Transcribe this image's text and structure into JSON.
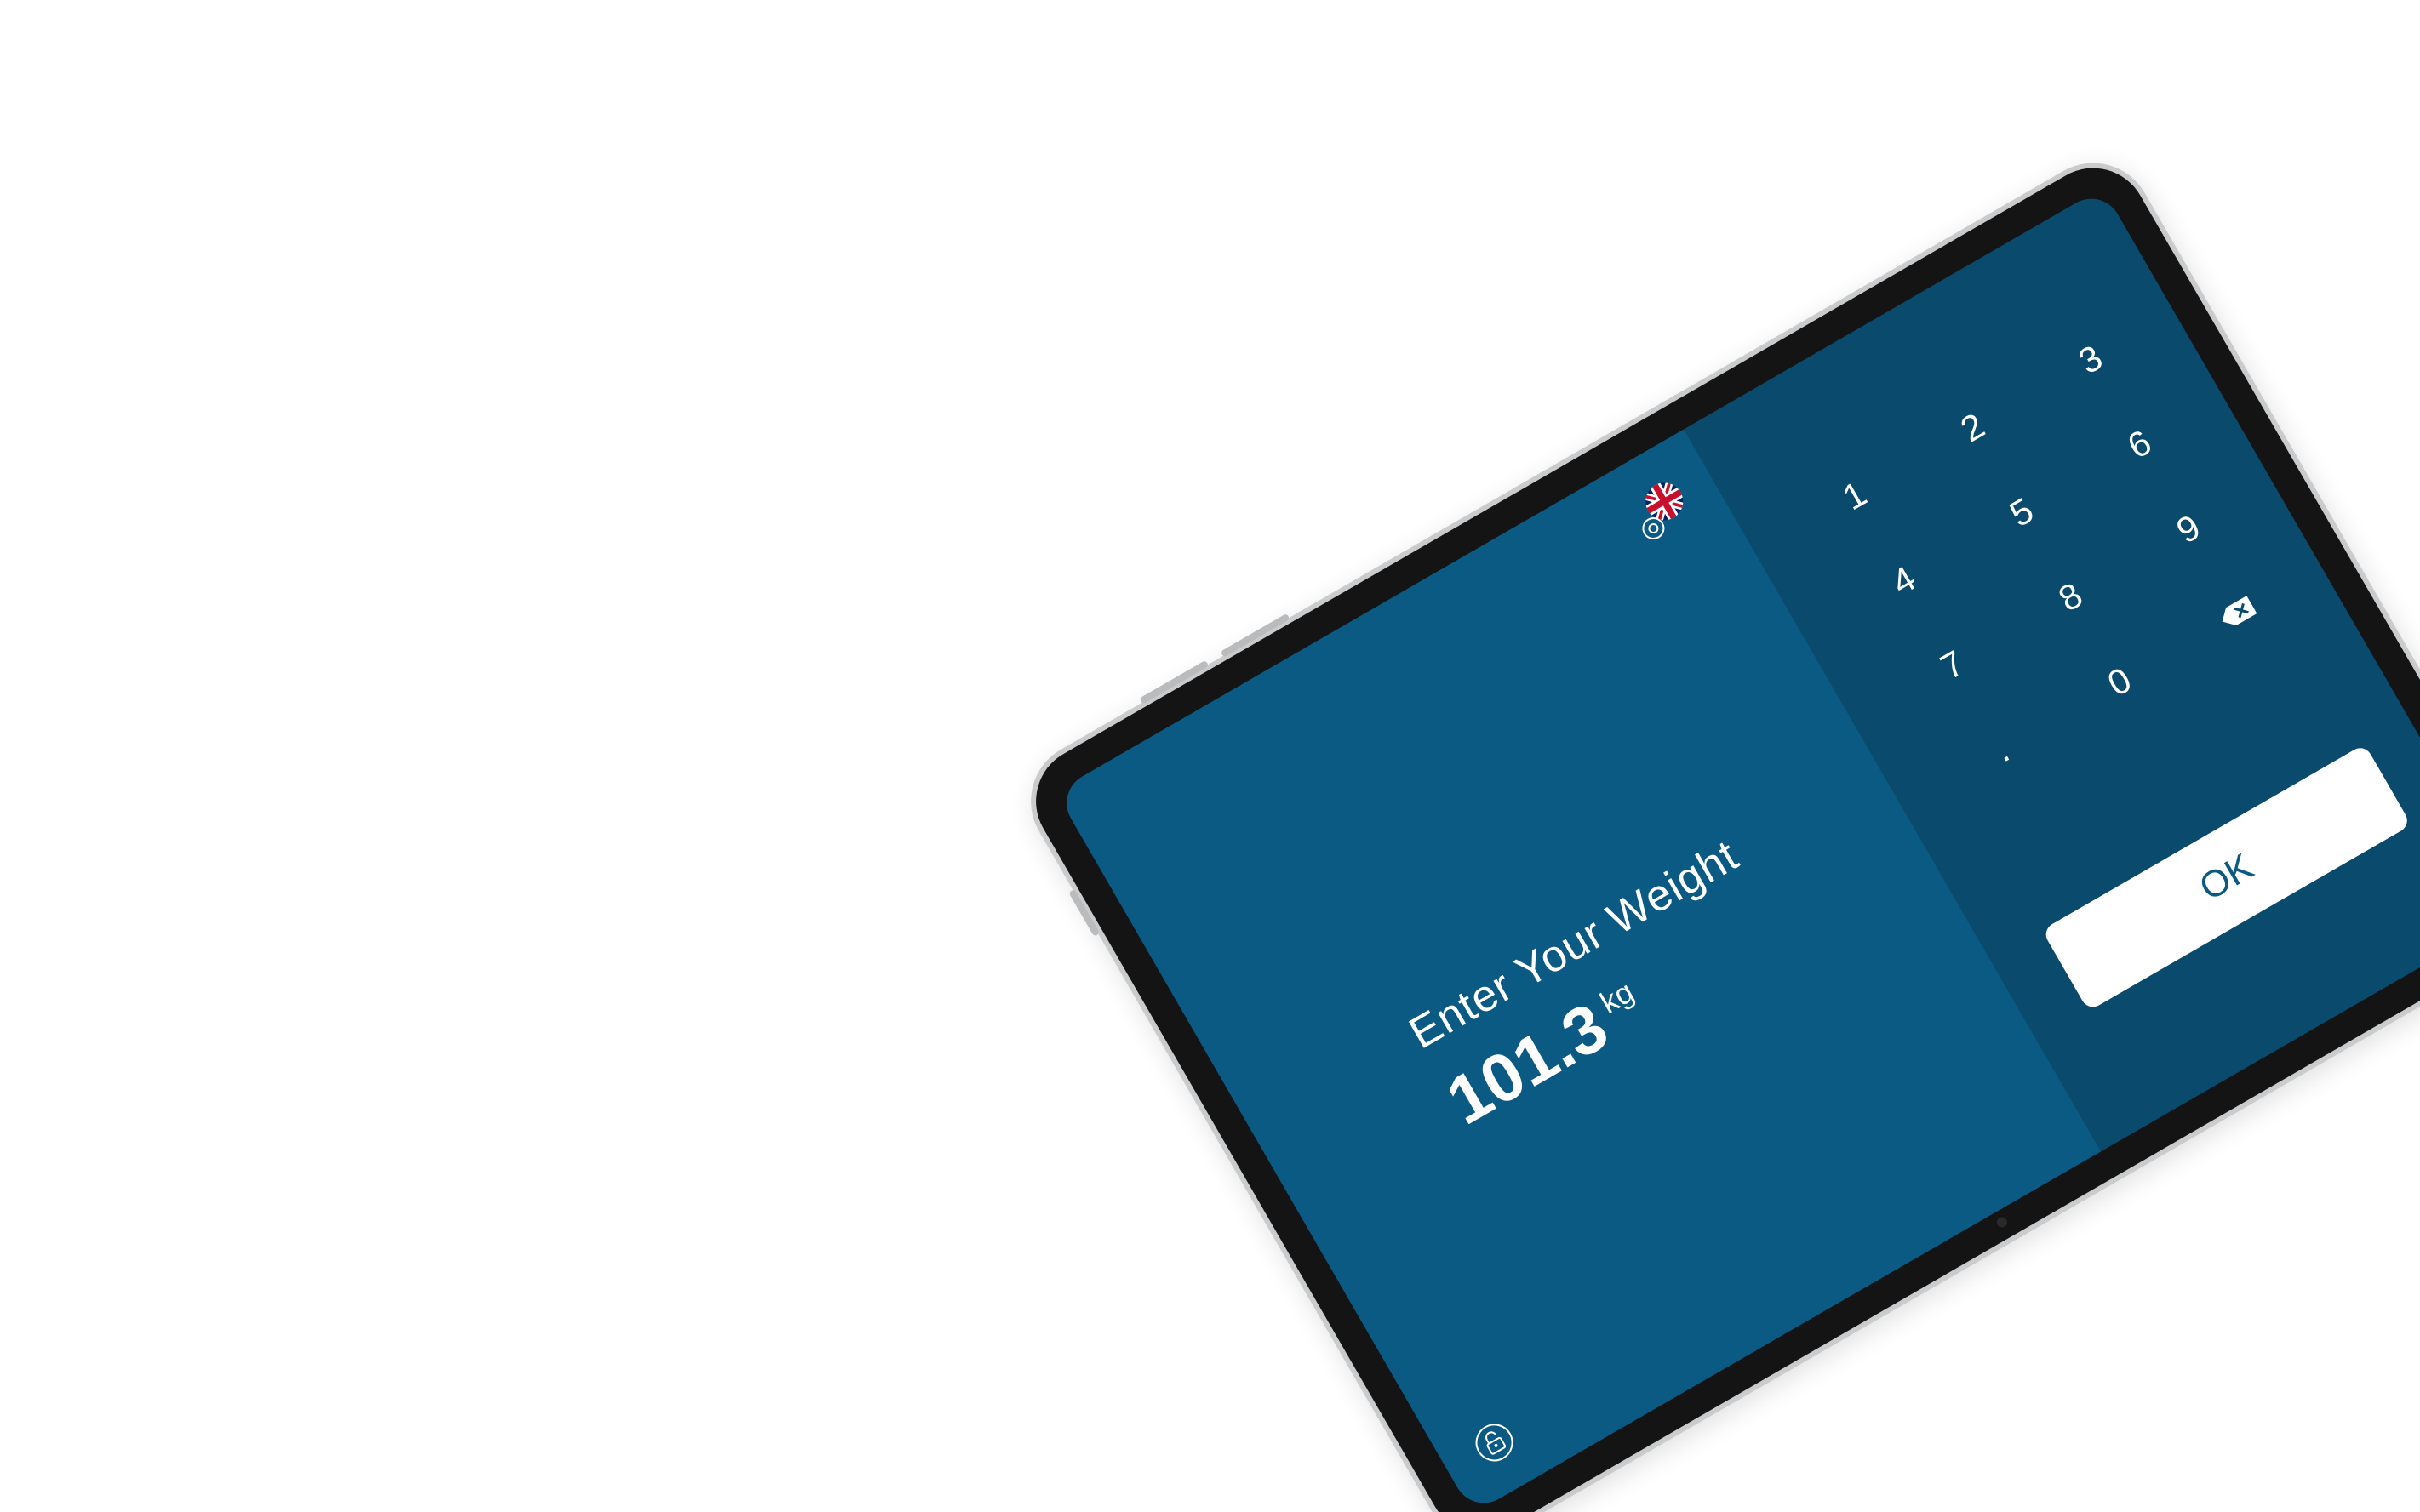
{
  "screen": {
    "title": "Enter Your Weight",
    "weight_value": "101.3",
    "weight_unit": "kg"
  },
  "keypad": {
    "keys": [
      "1",
      "2",
      "3",
      "4",
      "5",
      "6",
      "7",
      "8",
      "9",
      ".",
      "0"
    ],
    "backspace_icon": "backspace-icon",
    "ok_label": "OK"
  },
  "icons": {
    "language": "uk-flag-icon",
    "settings": "settings-icon",
    "lock": "lock-icon"
  },
  "colors": {
    "primary_panel": "#0b5a83",
    "keypad_panel": "#0a4a6d",
    "text": "#ffffff",
    "button_background": "#ffffff",
    "button_text": "#0b5a83"
  }
}
